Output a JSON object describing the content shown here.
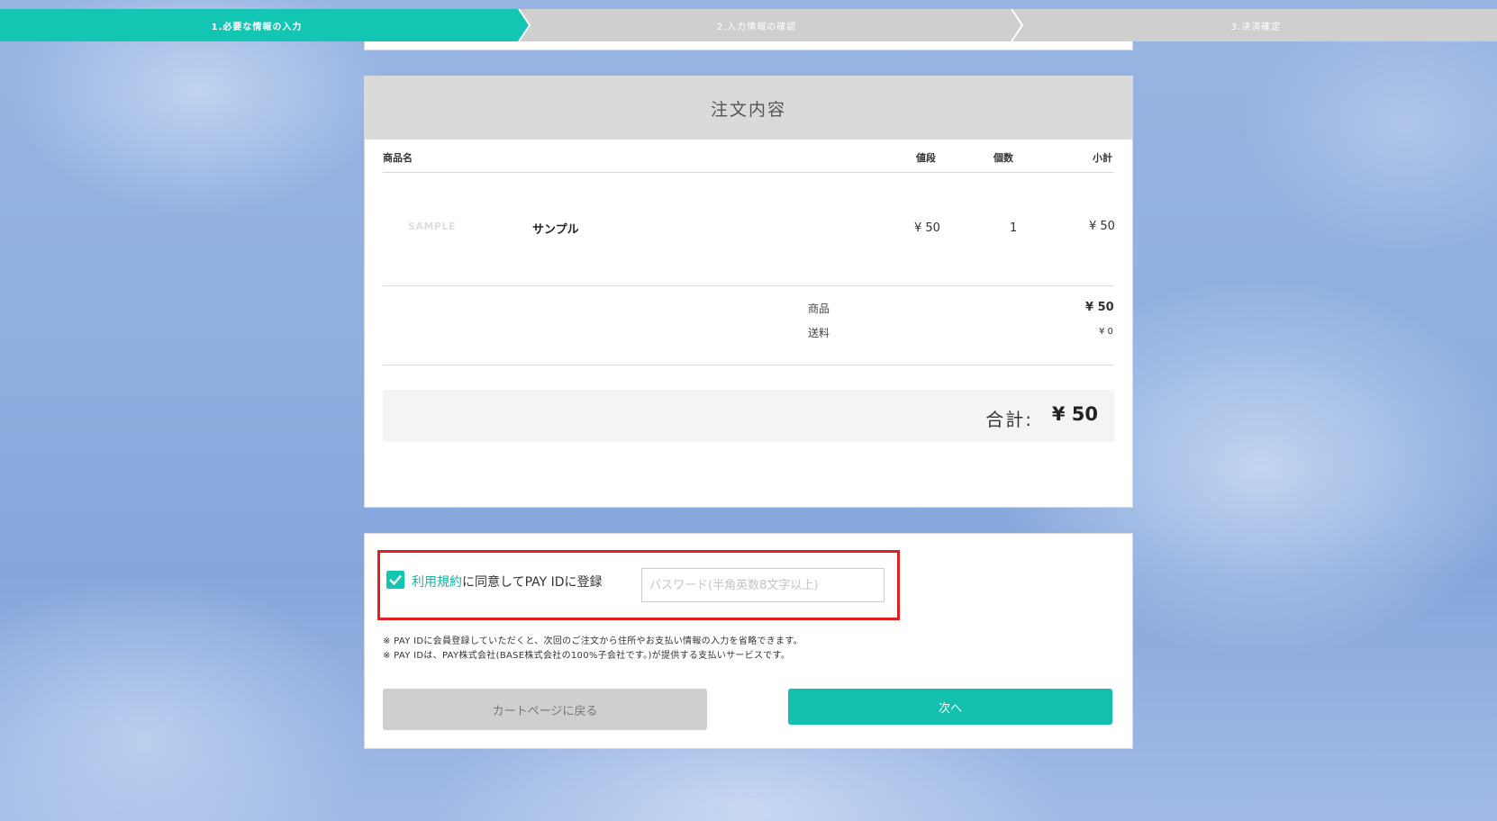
{
  "steps": [
    {
      "label": "1.必要な情報の入力",
      "active": true
    },
    {
      "label": "2.入力情報の確認",
      "active": false
    },
    {
      "label": "3.決済確定",
      "active": false
    }
  ],
  "order": {
    "title": "注文内容",
    "columns": {
      "name": "商品名",
      "price": "値段",
      "qty": "個数",
      "subtotal": "小計"
    },
    "item": {
      "image_text": "SAMPLE",
      "name": "サンプル",
      "price": "¥ 50",
      "qty": "1",
      "subtotal": "¥ 50"
    },
    "summary": {
      "products_label": "商品",
      "products_value": "¥ 50",
      "shipping_label": "送料",
      "shipping_value": "¥ 0"
    },
    "total_label": "合計:",
    "total_value": "¥ 50"
  },
  "payid": {
    "checked": true,
    "terms_link": "利用規約",
    "agree_text": "に同意してPAY IDに登録",
    "password_placeholder": "パスワード(半角英数8文字以上)",
    "notes": [
      "※ PAY IDに会員登録していただくと、次回のご注文から住所やお支払い情報の入力を省略できます。",
      "※ PAY IDは、PAY株式会社(BASE株式会社の100%子会社です。)が提供する支払いサービスです。"
    ]
  },
  "buttons": {
    "back": "カートページに戻る",
    "next": "次へ"
  },
  "footer": {
    "logo": "BASE"
  },
  "colors": {
    "accent": "#13c6b3",
    "alert": "#e02020"
  }
}
